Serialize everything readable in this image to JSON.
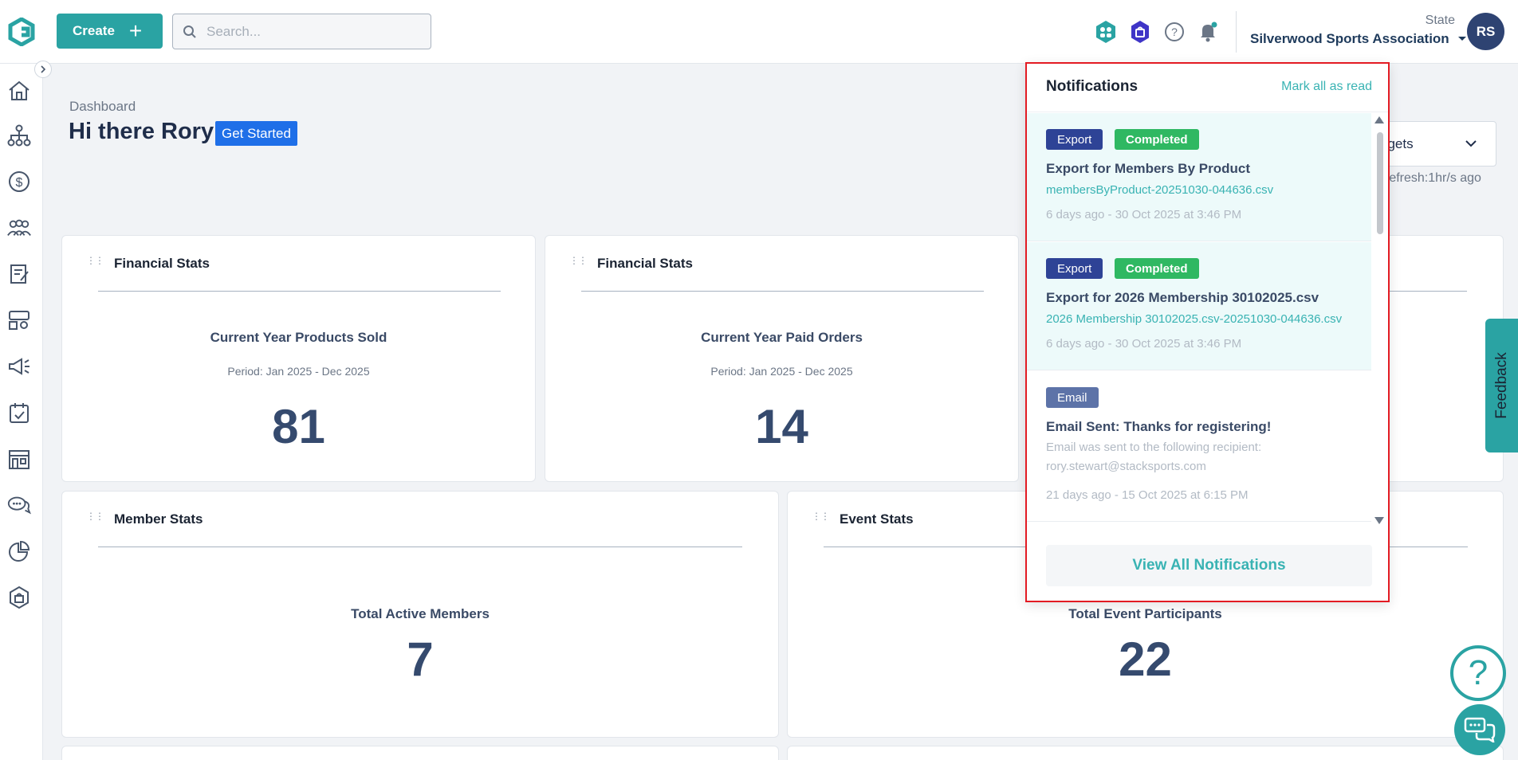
{
  "header": {
    "create_label": "Create",
    "search_placeholder": "Search...",
    "org_type": "State",
    "org_name": "Silverwood Sports Association",
    "avatar_initials": "RS"
  },
  "page": {
    "breadcrumb": "Dashboard",
    "greeting": "Hi there Rory",
    "get_started": "Get Started",
    "widgets_select_label": "dgets",
    "refresh_text": "refresh:1hr/s ago"
  },
  "cards": {
    "financial1": {
      "title": "Financial Stats",
      "label": "Current Year Products Sold",
      "period": "Period: Jan 2025 - Dec 2025",
      "value": "81"
    },
    "financial2": {
      "title": "Financial Stats",
      "label": "Current Year Paid Orders",
      "period": "Period: Jan 2025 - Dec 2025",
      "value": "14"
    },
    "members": {
      "title": "Member Stats",
      "label": "Total Active Members",
      "value": "7"
    },
    "events": {
      "title": "Event Stats",
      "label": "Total Event Participants",
      "value": "22"
    }
  },
  "feedback_label": "Feedback",
  "notifications": {
    "title": "Notifications",
    "mark_all": "Mark all as read",
    "view_all": "View All Notifications",
    "items": [
      {
        "type": "Export",
        "status": "Completed",
        "title": "Export for Members By Product",
        "file": "membersByProduct-20251030-044636.csv",
        "time": "6 days ago - 30 Oct 2025 at 3:46 PM"
      },
      {
        "type": "Export",
        "status": "Completed",
        "title": "Export for 2026 Membership 30102025.csv",
        "file": "2026 Membership 30102025.csv-20251030-044636.csv",
        "time": "6 days ago - 30 Oct 2025 at 3:46 PM"
      },
      {
        "type": "Email",
        "title": "Email Sent: Thanks for registering!",
        "desc": "Email was sent to the following recipient: rory.stewart@stacksports.com",
        "time": "21 days ago - 15 Oct 2025 at 6:15 PM"
      }
    ]
  },
  "colors": {
    "accent": "#2aa3a3",
    "navy": "#2e4372",
    "highlight_border": "#e31b23"
  }
}
